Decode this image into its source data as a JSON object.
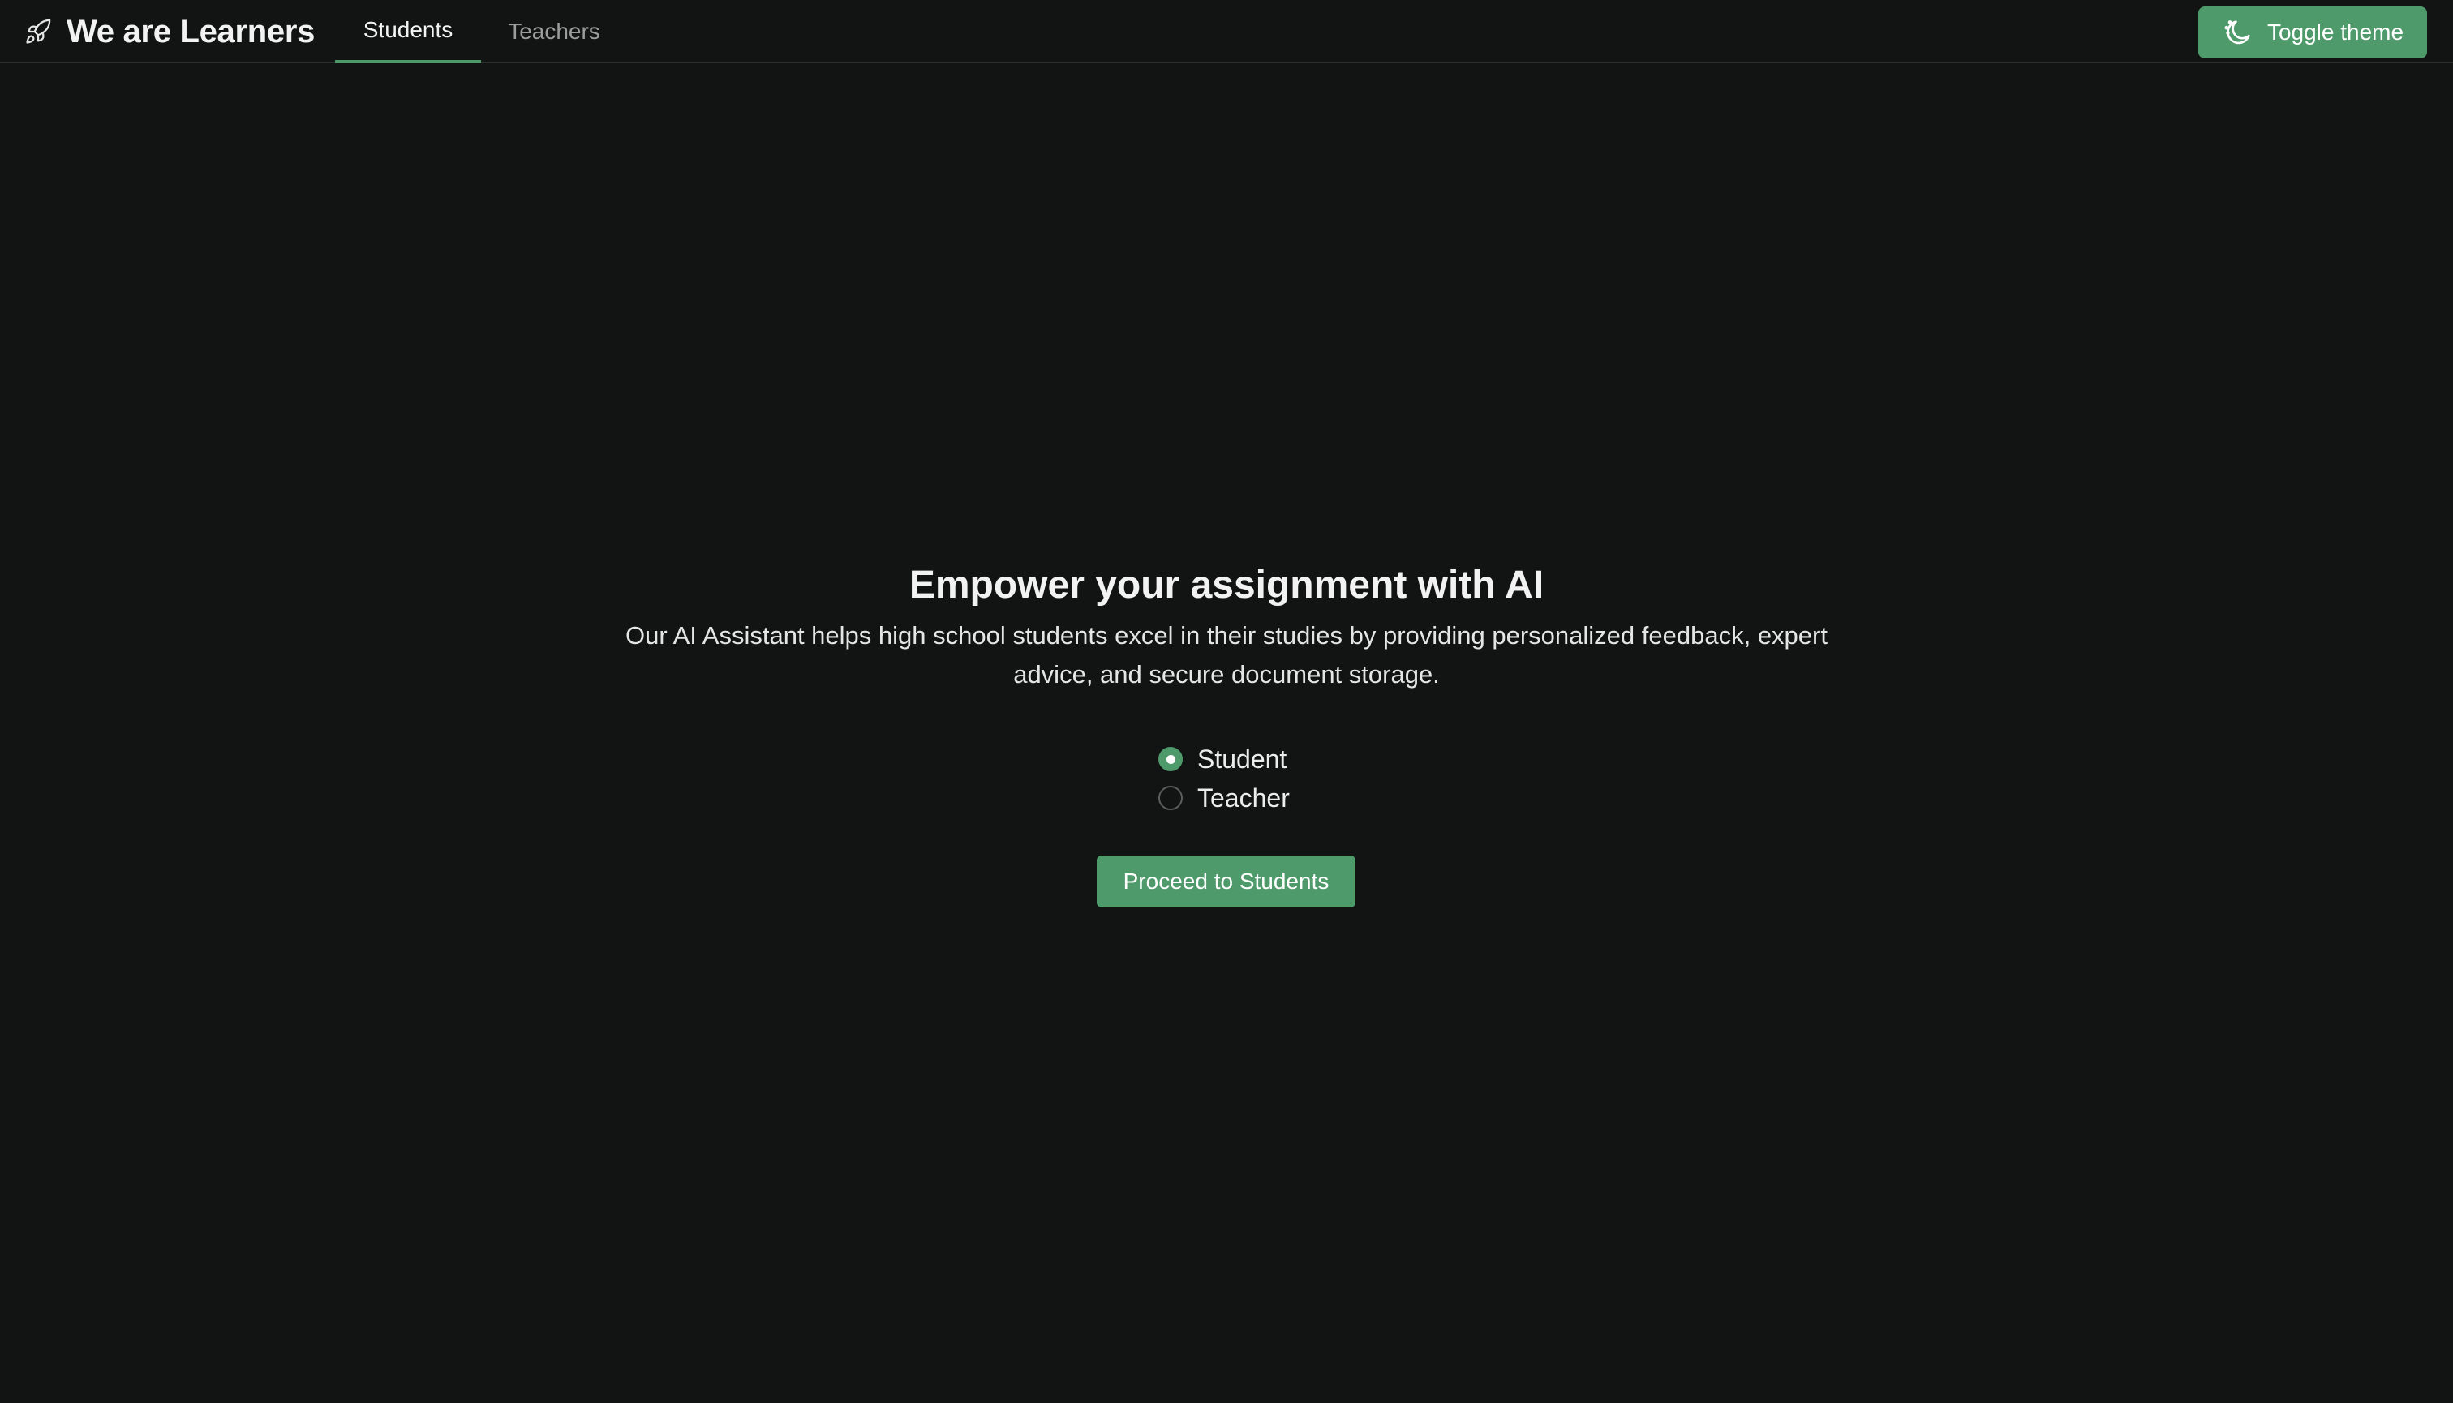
{
  "brand": {
    "title": "We are Learners",
    "icon": "rocket-icon"
  },
  "nav": {
    "tabs": [
      {
        "label": "Students",
        "active": true
      },
      {
        "label": "Teachers",
        "active": false
      }
    ]
  },
  "header": {
    "toggle_theme_label": "Toggle theme",
    "toggle_theme_icon": "moon-stars-icon"
  },
  "hero": {
    "title": "Empower your assignment with AI",
    "description": "Our AI Assistant helps high school students excel in their studies by providing personalized feedback, expert advice, and secure document storage."
  },
  "role_selector": {
    "selected": "Student",
    "options": [
      {
        "label": "Student",
        "checked": true
      },
      {
        "label": "Teacher",
        "checked": false
      }
    ]
  },
  "cta": {
    "label": "Proceed to Students"
  },
  "colors": {
    "background": "#111413",
    "accent": "#4e9a6a",
    "text": "#ececec",
    "muted_text": "#9a9e9c"
  }
}
